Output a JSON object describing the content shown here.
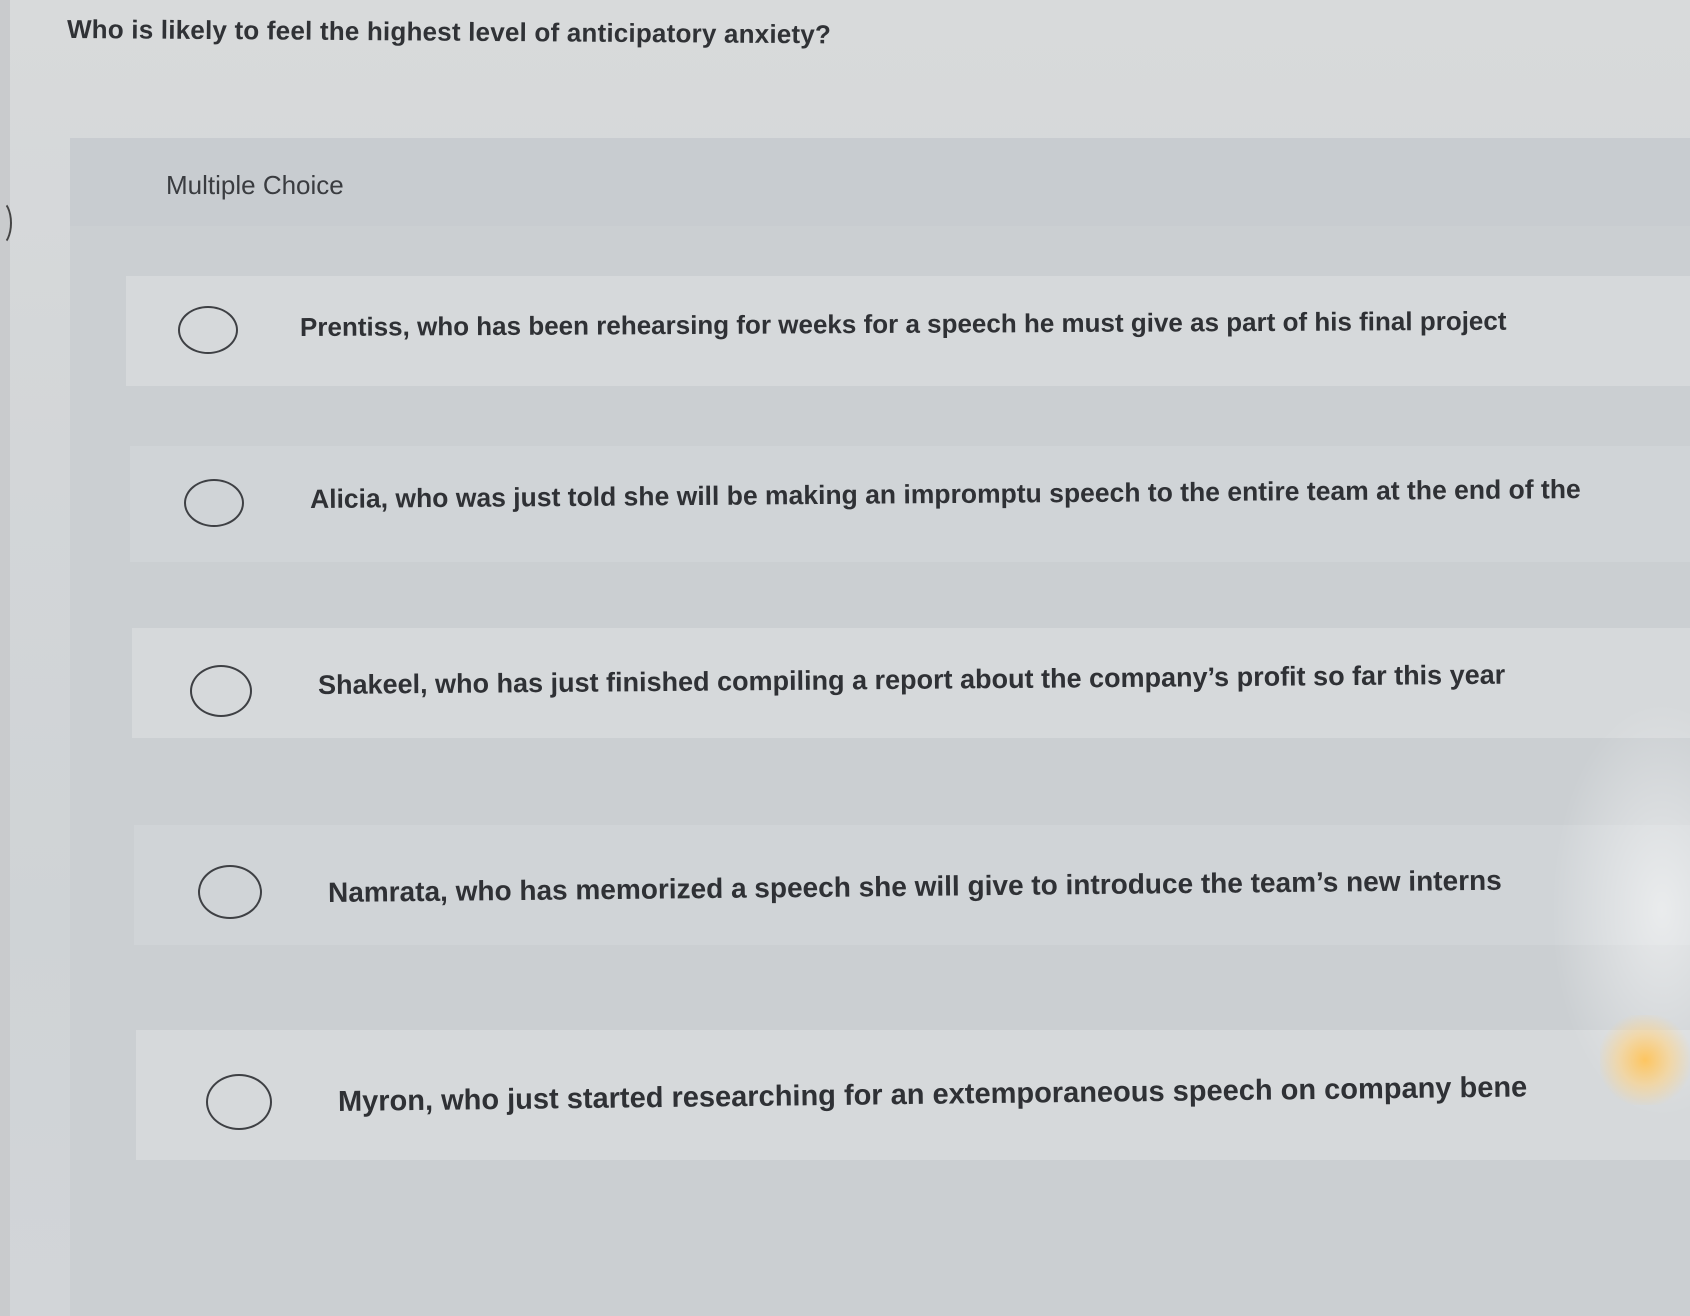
{
  "question": {
    "text": "Who is likely to feel the highest level of anticipatory anxiety?"
  },
  "panel": {
    "type_label": "Multiple Choice"
  },
  "options": [
    {
      "label": "Prentiss, who has been rehearsing for weeks for a speech he must give as part of his final project",
      "selected": false
    },
    {
      "label": "Alicia, who was just told she will be making an impromptu speech to the entire team at the end of the",
      "selected": false
    },
    {
      "label": "Shakeel, who has just finished compiling a report about the company’s profit so far this year",
      "selected": false
    },
    {
      "label": "Namrata, who has memorized a speech she will give to introduce the team’s new interns",
      "selected": false
    },
    {
      "label": "Myron, who just started researching for an extemporaneous speech on company bene",
      "selected": false
    }
  ]
}
